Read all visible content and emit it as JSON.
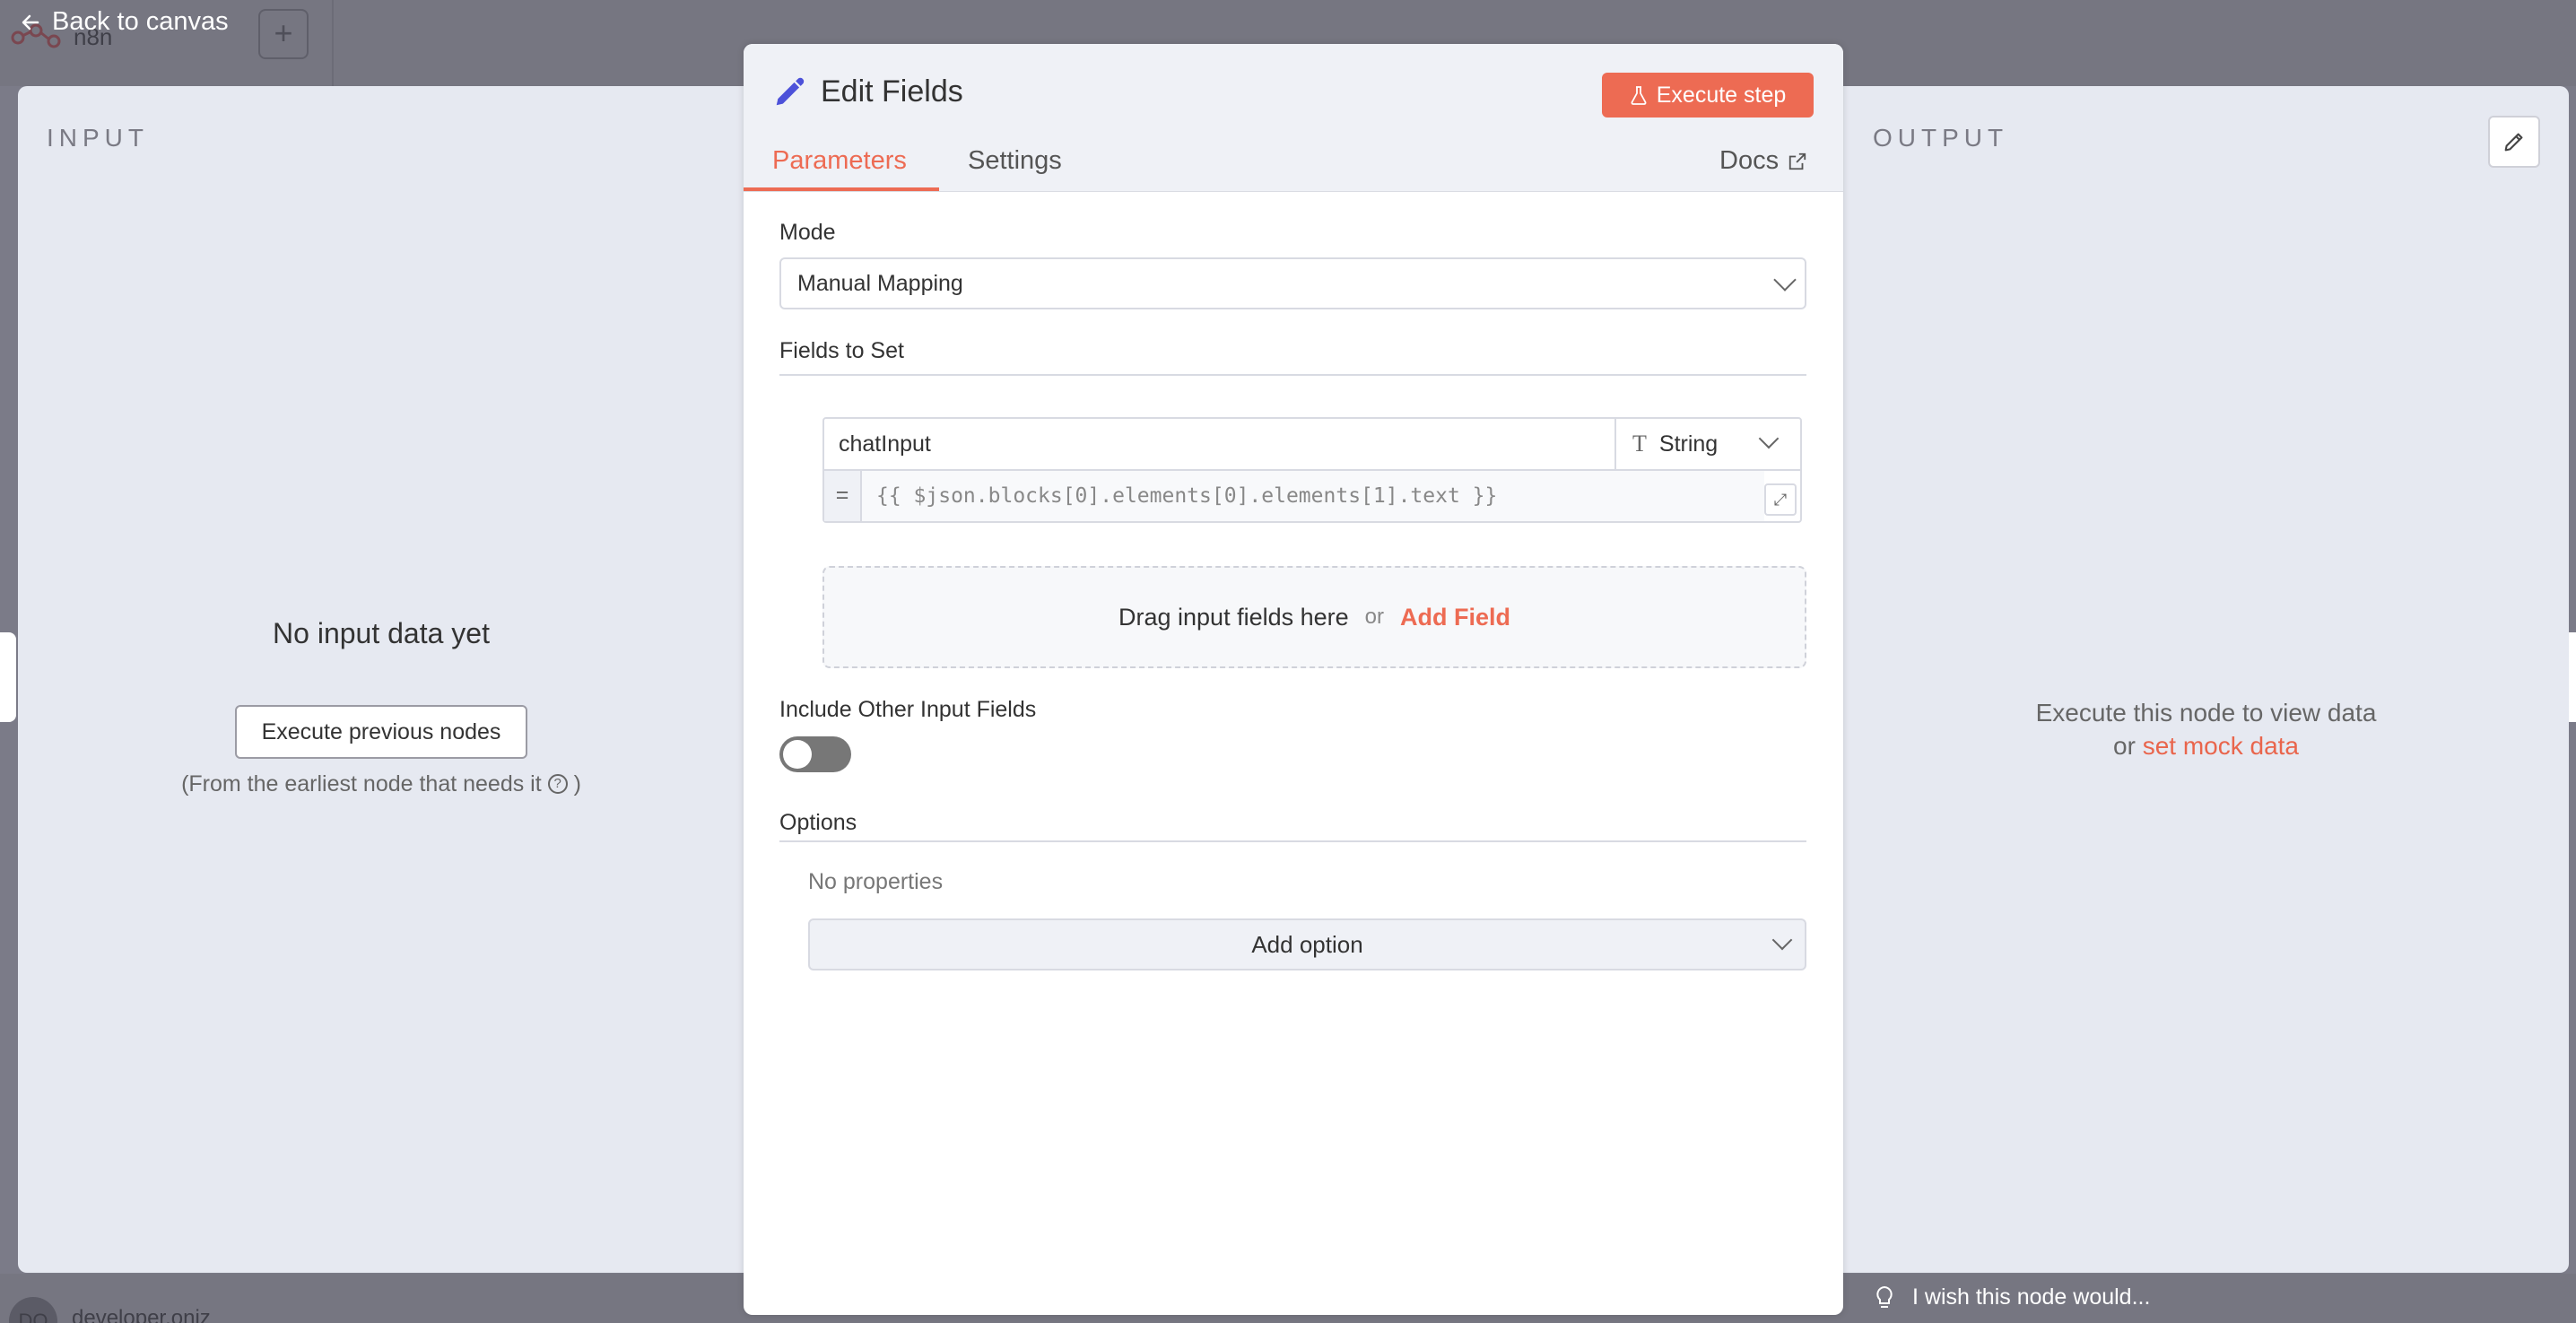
{
  "background": {
    "app_name": "n8n",
    "user_initials": "DO",
    "user_name": "developer.oniz"
  },
  "nav": {
    "back_label": "Back to canvas"
  },
  "input_panel": {
    "title": "INPUT",
    "empty_title": "No input data yet",
    "execute_previous_label": "Execute previous nodes",
    "note": "(From the earliest node that needs it",
    "note_close": ")"
  },
  "output_panel": {
    "title": "OUTPUT",
    "message": "Execute this node to view data",
    "or_text": "or",
    "mock_link": "set mock data",
    "wish_text": "I wish this node would..."
  },
  "modal": {
    "title": "Edit Fields",
    "execute_step_label": "Execute step",
    "tabs": {
      "parameters": "Parameters",
      "settings": "Settings"
    },
    "docs_label": "Docs",
    "mode": {
      "label": "Mode",
      "value": "Manual Mapping"
    },
    "fields_to_set": {
      "label": "Fields to Set",
      "field": {
        "name": "chatInput",
        "type": "String",
        "equals": "=",
        "value": "{{ $json.blocks[0].elements[0].elements[1].text }}"
      },
      "drop_text": "Drag input fields here",
      "or_text": "or",
      "add_field_label": "Add Field"
    },
    "include_other": {
      "label": "Include Other Input Fields",
      "enabled": false
    },
    "options": {
      "label": "Options",
      "no_properties": "No properties",
      "add_option_label": "Add option"
    }
  },
  "colors": {
    "accent": "#ed6b53",
    "panel_bg": "#e6e9f1",
    "overlay": "#7b7b88"
  }
}
